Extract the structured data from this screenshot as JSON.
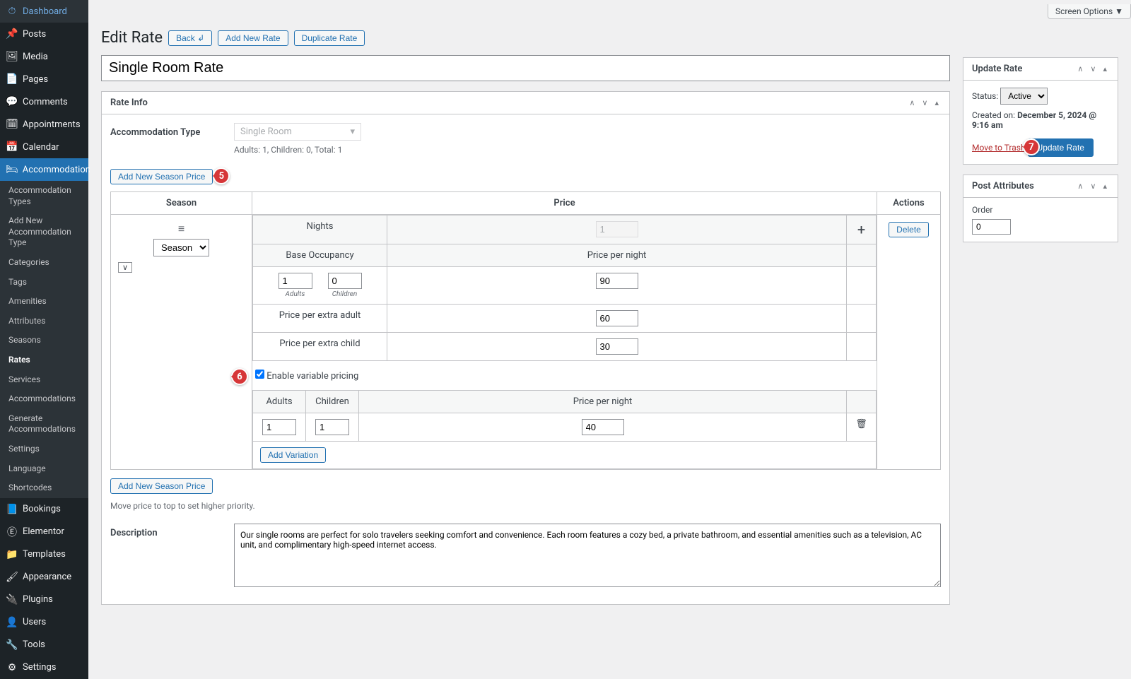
{
  "topbar": {
    "screen_options": "Screen Options"
  },
  "sidebar": {
    "items": [
      {
        "label": "Dashboard"
      },
      {
        "label": "Posts"
      },
      {
        "label": "Media"
      },
      {
        "label": "Pages"
      },
      {
        "label": "Comments"
      },
      {
        "label": "Appointments"
      },
      {
        "label": "Calendar"
      },
      {
        "label": "Accommodation"
      },
      {
        "label": "Bookings"
      },
      {
        "label": "Elementor"
      },
      {
        "label": "Templates"
      },
      {
        "label": "Appearance"
      },
      {
        "label": "Plugins"
      },
      {
        "label": "Users"
      },
      {
        "label": "Tools"
      },
      {
        "label": "Settings"
      }
    ],
    "submenu": [
      "Accommodation Types",
      "Add New Accommodation Type",
      "Categories",
      "Tags",
      "Amenities",
      "Attributes",
      "Seasons",
      "Rates",
      "Services",
      "Accommodations",
      "Generate Accommodations",
      "Settings",
      "Language",
      "Shortcodes"
    ]
  },
  "page": {
    "title": "Edit Rate",
    "back": "Back ↲",
    "add_new": "Add New Rate",
    "duplicate": "Duplicate Rate",
    "rate_name": "Single Room Rate"
  },
  "rate_info": {
    "box_title": "Rate Info",
    "accom_type_label": "Accommodation Type",
    "accom_type_value": "Single Room",
    "accom_type_helper": "Adults: 1, Children: 0, Total: 1",
    "add_season_price": "Add New Season Price",
    "columns": {
      "season": "Season",
      "price": "Price",
      "actions": "Actions"
    },
    "season_select": "Season",
    "delete": "Delete",
    "nights_label": "Nights",
    "nights_value": "1",
    "base_occupancy": "Base Occupancy",
    "price_per_night": "Price per night",
    "adults_val": "1",
    "adults_lbl": "Adults",
    "children_val": "0",
    "children_lbl": "Children",
    "base_price": "90",
    "extra_adult_label": "Price per extra adult",
    "extra_adult_price": "60",
    "extra_child_label": "Price per extra child",
    "extra_child_price": "30",
    "enable_variable": "Enable variable pricing",
    "var_adults": "Adults",
    "var_children": "Children",
    "var_price": "Price per night",
    "var_row": {
      "adults": "1",
      "children": "1",
      "price": "40"
    },
    "add_variation": "Add Variation",
    "add_season_price_2": "Add New Season Price",
    "hint": "Move price to top to set higher priority.",
    "description_label": "Description",
    "description_value": "Our single rooms are perfect for solo travelers seeking comfort and convenience. Each room features a cozy bed, a private bathroom, and essential amenities such as a television, AC unit, and complimentary high-speed internet access."
  },
  "update_box": {
    "title": "Update Rate",
    "status_label": "Status:",
    "status_value": "Active",
    "created_label": "Created on:",
    "created_value": "December 5, 2024 @ 9:16 am",
    "trash": "Move to Trash",
    "update": "Update Rate"
  },
  "attr_box": {
    "title": "Post Attributes",
    "order_label": "Order",
    "order_value": "0"
  },
  "badges": {
    "b5": "5",
    "b6": "6",
    "b7": "7"
  }
}
